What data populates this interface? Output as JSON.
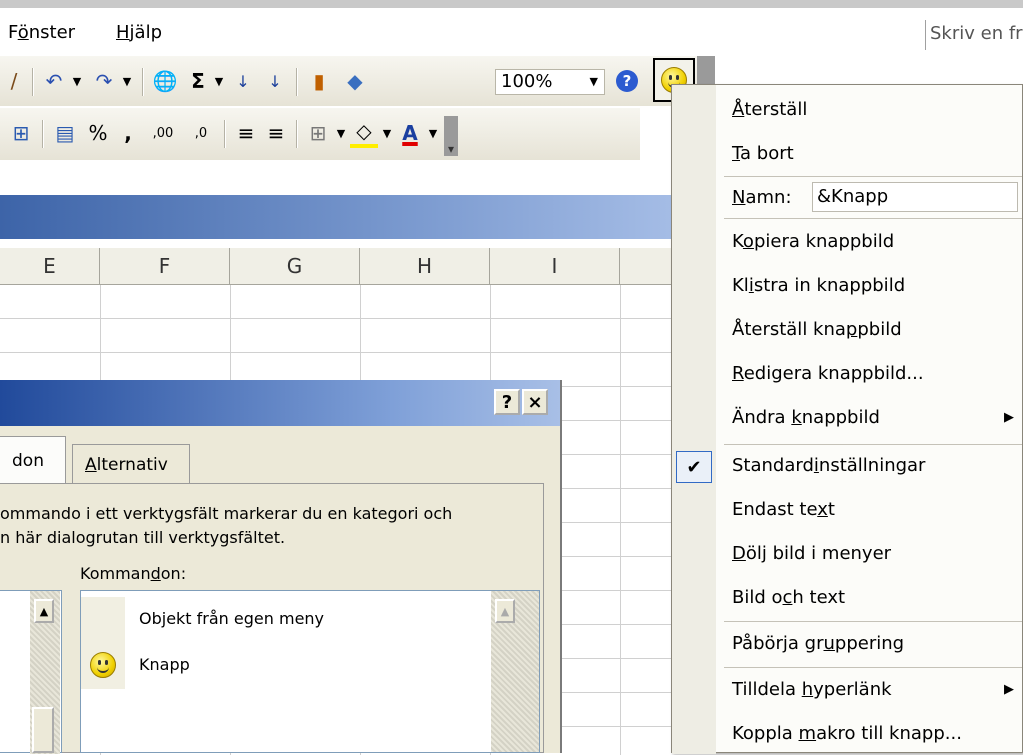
{
  "menubar": {
    "items": [
      {
        "pre": "F",
        "u": "ö",
        "post": "nster"
      },
      {
        "pre": "",
        "u": "H",
        "post": "jälp"
      }
    ],
    "help_placeholder": "Skriv en fr"
  },
  "toolbar": {
    "zoom": "100%",
    "sigma": "Σ",
    "percent": "%",
    "comma": ",",
    "dec_inc": ",00",
    "dec_dec": ",0",
    "font_a": "A"
  },
  "sheet": {
    "columns": [
      "E",
      "F",
      "G",
      "H",
      "I"
    ]
  },
  "dialog": {
    "help_btn": "?",
    "close_btn": "×",
    "tabs": [
      {
        "pre": "",
        "u": "",
        "post": "don"
      },
      {
        "pre": "",
        "u": "A",
        "post": "lternativ"
      }
    ],
    "line1": "ommando i ett verktygsfält markerar du en kategori och",
    "line2": "n här dialogrutan till verktygsfältet.",
    "commands_label_pre": "Komman",
    "commands_label_u": "d",
    "commands_label_post": "on:",
    "commands": [
      {
        "label": "Objekt från egen meny",
        "icon": ""
      },
      {
        "label": "Knapp",
        "icon": "smiley-icon"
      }
    ]
  },
  "context_menu": {
    "reset": {
      "pre": "",
      "u": "Å",
      "post": "terställ"
    },
    "delete": {
      "pre": "",
      "u": "T",
      "post": "a bort"
    },
    "name_label": {
      "pre": "",
      "u": "N",
      "post": "amn:"
    },
    "name_value": "&Knapp",
    "copy_image": {
      "pre": "K",
      "u": "o",
      "post": "piera knappbild"
    },
    "paste_image": {
      "pre": "Kl",
      "u": "i",
      "post": "stra in knappbild"
    },
    "reset_image": {
      "pre": "Återställ kna",
      "u": "p",
      "post": "pbild"
    },
    "edit_image": {
      "pre": "",
      "u": "R",
      "post": "edigera knappbild..."
    },
    "change_image": {
      "pre": "Ändra ",
      "u": "k",
      "post": "nappbild"
    },
    "default_style": {
      "pre": "Standard",
      "u": "i",
      "post": "nställningar"
    },
    "text_only": {
      "pre": "Endast te",
      "u": "x",
      "post": "t"
    },
    "hide_image": {
      "pre": "",
      "u": "D",
      "post": "ölj bild i menyer"
    },
    "image_text": {
      "pre": "Bild o",
      "u": "c",
      "post": "h text"
    },
    "begin_group": {
      "pre": "Påbörja gr",
      "u": "u",
      "post": "ppering"
    },
    "assign_link": {
      "pre": "Tilldela ",
      "u": "h",
      "post": "yperlänk"
    },
    "assign_macro": {
      "pre": "Koppla ",
      "u": "m",
      "post": "akro till knapp..."
    },
    "check": "✔"
  }
}
